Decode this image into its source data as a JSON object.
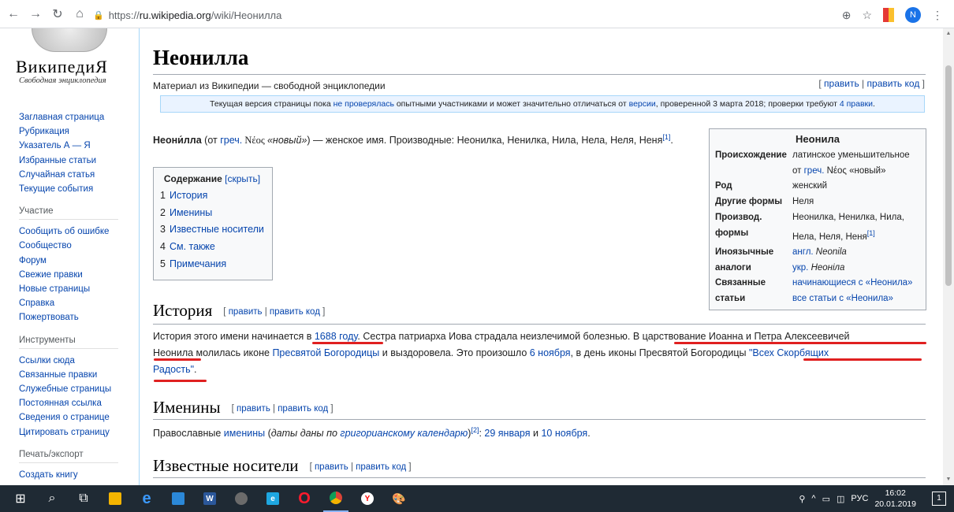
{
  "browser": {
    "url_scheme": "https://",
    "url_host": "ru.wikipedia.org",
    "url_path": "/wiki/Неонилла",
    "profile_initial": "N"
  },
  "sidebar": {
    "logo_title": "ВикипедиЯ",
    "logo_subtitle": "Свободная энциклопедия",
    "nav": [
      "Заглавная страница",
      "Рубрикация",
      "Указатель А — Я",
      "Избранные статьи",
      "Случайная статья",
      "Текущие события"
    ],
    "participation_head": "Участие",
    "participation": [
      "Сообщить об ошибке",
      "Сообщество",
      "Форум",
      "Свежие правки",
      "Новые страницы",
      "Справка",
      "Пожертвовать"
    ],
    "tools_head": "Инструменты",
    "tools": [
      "Ссылки сюда",
      "Связанные правки",
      "Служебные страницы",
      "Постоянная ссылка",
      "Сведения о странице",
      "Цитировать страницу"
    ],
    "print_head": "Печать/экспорт",
    "print": [
      "Создать книгу"
    ]
  },
  "article": {
    "title": "Неонилла",
    "tagline": "Материал из Википедии — свободной энциклопедии",
    "edit": "править",
    "edit_code": "править код",
    "flagged_pre": "Текущая версия страницы пока",
    "flagged_link1": "не проверялась",
    "flagged_mid": "опытными участниками и может значительно отличаться от",
    "flagged_link2": "версии",
    "flagged_post": ", проверенной 3 марта 2018; проверки требуют",
    "flagged_link3": "4 правки",
    "lead_bold": "Неони́лла",
    "lead_p1": " (от ",
    "lead_greek_link": "греч.",
    "lead_greek": " Νέος ",
    "lead_greek_gloss": "«новый»",
    "lead_rest": ") — женское имя. Производные: Неонилка, Ненилка, Нила, Нела, Неля, Неня",
    "lead_ref": "[1]",
    "toc_title": "Содержание",
    "toc_hide": "[скрыть]",
    "toc": [
      {
        "num": "1",
        "label": "История"
      },
      {
        "num": "2",
        "label": "Именины"
      },
      {
        "num": "3",
        "label": "Известные носители"
      },
      {
        "num": "4",
        "label": "См. также"
      },
      {
        "num": "5",
        "label": "Примечания"
      }
    ],
    "history_h": "История",
    "history_p1": "История этого имени начинается ",
    "history_in": "в ",
    "history_year": "1688 году",
    "history_p2": ". Сестра патриарха Иова страдала неизлечимой болезнью. ",
    "history_p3": "В царствование Иоанна и Петра Алексеевичей",
    "history_p4": " Неонила",
    "history_p5": " молилась иконе ",
    "history_icon_link": "Пресвятой Богородицы",
    "history_p6": " и выздоровела. Это произошло ",
    "history_date": "6 ноября",
    "history_p7": ", в день иконы Пресвятой Богородицы ",
    "history_icon2": "\"Всех Скорбящих",
    "history_icon2b": "Радость\"",
    "history_end": ".",
    "namedays_h": "Именины",
    "namedays_p1": "Православные ",
    "namedays_link": "именины",
    "namedays_p2": " (",
    "namedays_italic1": "даты даны по ",
    "namedays_italic_link": "григорианскому календарю",
    "namedays_p3": ")",
    "namedays_ref": "[2]",
    "namedays_p4": ": ",
    "namedays_d1": "29 января",
    "namedays_and": " и ",
    "namedays_d2": "10 ноября",
    "namedays_end": ".",
    "bearers_h": "Известные носители"
  },
  "infobox": {
    "title": "Неонила",
    "origin_label": "Происхождение",
    "origin_text": "латинское уменьшительное от ",
    "origin_link": "греч.",
    "origin_greek": " Νέος «новый»",
    "gender_label": "Род",
    "gender_value": "женский",
    "other_label": "Другие формы",
    "other_value": "Неля",
    "deriv_label": "Производ. формы",
    "deriv_value": "Неонилка, Ненилка, Нила, Нела, Неля, Неня",
    "deriv_ref": "[1]",
    "foreign_label": "Иноязычные аналоги",
    "foreign_en_link": "англ.",
    "foreign_en": " Neonila",
    "foreign_uk_link": "укр.",
    "foreign_uk": " Неоніла",
    "related_label": "Связанные статьи",
    "related_1": "начинающиеся с «Неонила»",
    "related_2": "все статьи с «Неонила»"
  },
  "taskbar": {
    "lang": "РУС",
    "time": "16:02",
    "date": "20.01.2019",
    "notif_count": "1"
  }
}
